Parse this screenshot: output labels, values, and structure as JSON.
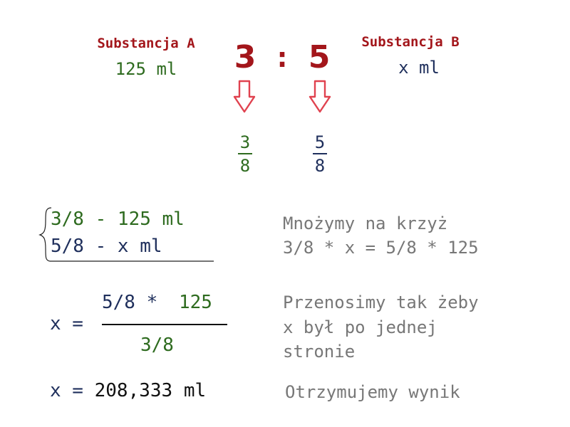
{
  "substance_a": {
    "label": "Substancja A",
    "amount": "125 ml"
  },
  "substance_b": {
    "label": "Substancja B",
    "amount": "x ml"
  },
  "ratio": {
    "left": "3",
    "separator": ":",
    "right": "5"
  },
  "fraction_a": {
    "numerator": "3",
    "denominator": "8"
  },
  "fraction_b": {
    "numerator": "5",
    "denominator": "8"
  },
  "proportion": {
    "line1": "3/8 - 125 ml",
    "line2": "5/8 - x ml"
  },
  "step1": {
    "line1": "Mnożymy na krzyż",
    "line2": "3/8 * x = 5/8 * 125"
  },
  "equation": {
    "lhs": "x =",
    "numerator_part1": "5/8 *",
    "numerator_part2": "125",
    "denominator": "3/8"
  },
  "step2": {
    "line1": "Przenosimy tak żeby",
    "line2": "x był po jednej",
    "line3": "stronie"
  },
  "result": {
    "lhs": "x =",
    "value": "208,333 ml"
  },
  "step3": {
    "text": "Otrzymujemy wynik"
  },
  "colors": {
    "red": "#a3161b",
    "green": "#2e6b1f",
    "navy": "#1f2f5c",
    "gray": "#777777",
    "arrow_stroke": "#e0424f"
  },
  "icons": [
    "down-arrow-icon",
    "brace-icon"
  ]
}
